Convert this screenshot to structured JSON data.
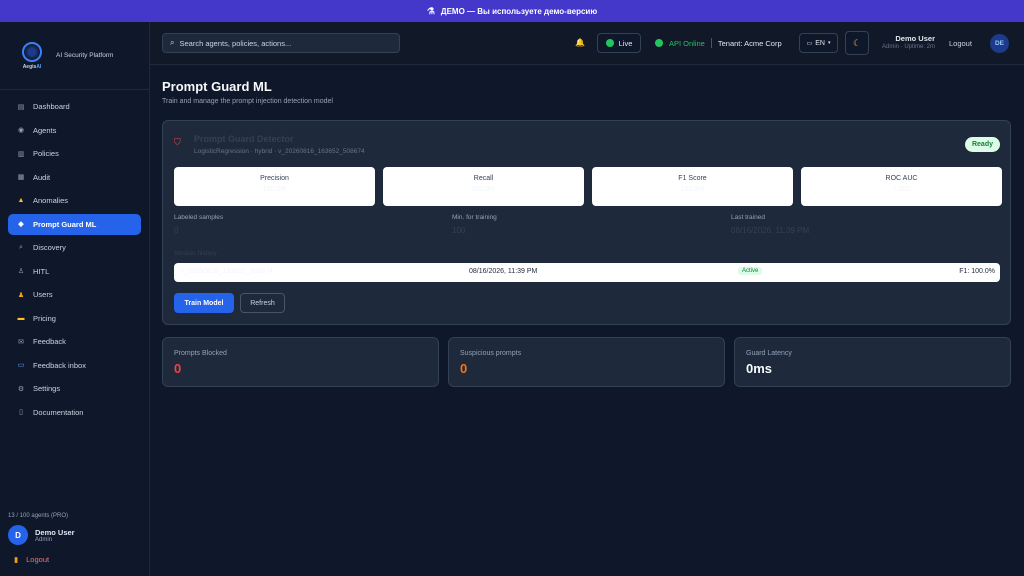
{
  "banner": {
    "text": "ДЕМО — Вы используете демо-версию",
    "icon": "flask-icon"
  },
  "brand": {
    "logo_name": "Aegis",
    "logo_accent": "AI",
    "subtitle": "AI Security Platform"
  },
  "sidebar": {
    "items": [
      {
        "label": "Dashboard",
        "icon": "chart-icon",
        "glyph": "▤",
        "active": false
      },
      {
        "label": "Agents",
        "icon": "robot-icon",
        "glyph": "◉",
        "active": false
      },
      {
        "label": "Policies",
        "icon": "clipboard-icon",
        "glyph": "▥",
        "active": false
      },
      {
        "label": "Audit",
        "icon": "document-icon",
        "glyph": "▦",
        "active": false
      },
      {
        "label": "Anomalies",
        "icon": "warning-icon",
        "glyph": "▲",
        "active": false
      },
      {
        "label": "Prompt Guard ML",
        "icon": "shield-icon",
        "glyph": "◆",
        "active": true
      },
      {
        "label": "Discovery",
        "icon": "magnifier-icon",
        "glyph": "⌕",
        "active": false
      },
      {
        "label": "HITL",
        "icon": "person-icon",
        "glyph": "♙",
        "active": false
      },
      {
        "label": "Users",
        "icon": "users-icon",
        "glyph": "♟",
        "active": false
      },
      {
        "label": "Pricing",
        "icon": "card-icon",
        "glyph": "▬",
        "active": false
      },
      {
        "label": "Feedback",
        "icon": "envelope-icon",
        "glyph": "✉",
        "active": false
      },
      {
        "label": "Feedback inbox",
        "icon": "inbox-icon",
        "glyph": "▭",
        "active": false
      },
      {
        "label": "Settings",
        "icon": "gear-icon",
        "glyph": "⚙",
        "active": false
      },
      {
        "label": "Documentation",
        "icon": "book-icon",
        "glyph": "▯",
        "active": false
      }
    ],
    "quota": "13 / 100 agents (PRO)",
    "user": {
      "initial": "D",
      "name": "Demo User",
      "role": "Admin"
    },
    "logout": "Logout"
  },
  "topbar": {
    "search_placeholder": "Search agents, policies, actions...",
    "live": "Live",
    "api_status": "API Online",
    "tenant": "Tenant: Acme Corp",
    "lang": "EN",
    "user_name": "Demo User",
    "user_meta": "Admin · Uptime: 2m",
    "logout": "Logout",
    "avatar_initials": "DE"
  },
  "page": {
    "title": "Prompt Guard ML",
    "subtitle": "Train and manage the prompt injection detection model"
  },
  "detector": {
    "title": "Prompt Guard Detector",
    "subtitle": "LogisticRegression · hybrid · v_20260816_163652_508674",
    "status": "Ready",
    "metrics": [
      {
        "label": "Precision",
        "value": "100.0%"
      },
      {
        "label": "Recall",
        "value": "100.0%"
      },
      {
        "label": "F1 Score",
        "value": "100.0%"
      },
      {
        "label": "ROC AUC",
        "value": "1.000"
      }
    ],
    "labeled_samples_label": "Labeled samples",
    "labeled_samples_value": "0",
    "min_training_label": "Min. for training",
    "min_training_value": "100",
    "last_trained_label": "Last trained",
    "last_trained_value": "08/16/2026, 11:39 PM",
    "version_history_label": "Version history",
    "version": {
      "name": "v_20260816_163652_508674",
      "date": "08/16/2026, 11:39 PM",
      "status": "Active",
      "f1": "F1: 100.0%"
    },
    "train_button": "Train Model",
    "refresh_button": "Refresh"
  },
  "stats": [
    {
      "label": "Prompts Blocked",
      "value": "0",
      "color": "#ef4444"
    },
    {
      "label": "Suspicious prompts",
      "value": "0",
      "color": "#f97316"
    },
    {
      "label": "Guard Latency",
      "value": "0ms",
      "color": "#f8fafc"
    }
  ]
}
